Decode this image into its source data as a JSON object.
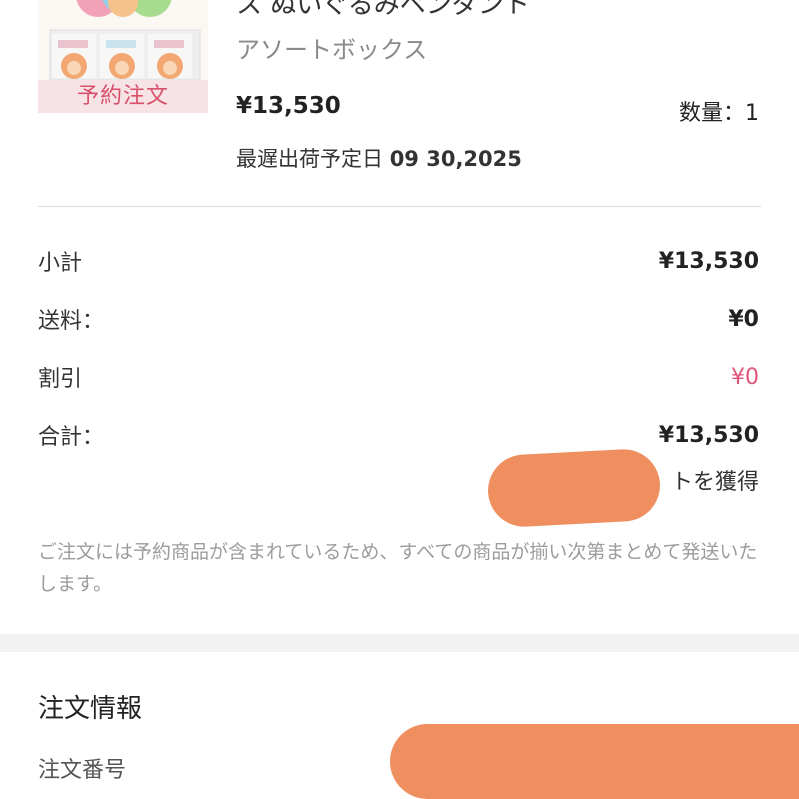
{
  "product": {
    "badge": "予約注文",
    "name": "ス ぬいぐるみペンダント",
    "variant": "アソートボックス",
    "price": "¥13,530",
    "quantity": "数量：1",
    "ship_label": "最遅出荷予定日",
    "ship_date": "09 30,2025"
  },
  "summary": {
    "subtotal_label": "小計",
    "subtotal_value": "¥13,530",
    "shipping_label": "送料：",
    "shipping_value": "¥0",
    "discount_label": "割引",
    "discount_value": "¥0",
    "total_label": "合計：",
    "total_value": "¥13,530",
    "points_text": "トを獲得"
  },
  "note": "ご注文には予約商品が含まれているため、すべての商品が揃い次第まとめて発送いたします。",
  "order_info": {
    "title": "注文情報",
    "number_label": "注文番号"
  },
  "colors": {
    "discount": "#e0557a",
    "redaction": "#ef8f5f",
    "badge_bg": "#f7e3e6",
    "badge_text": "#d8506c"
  }
}
